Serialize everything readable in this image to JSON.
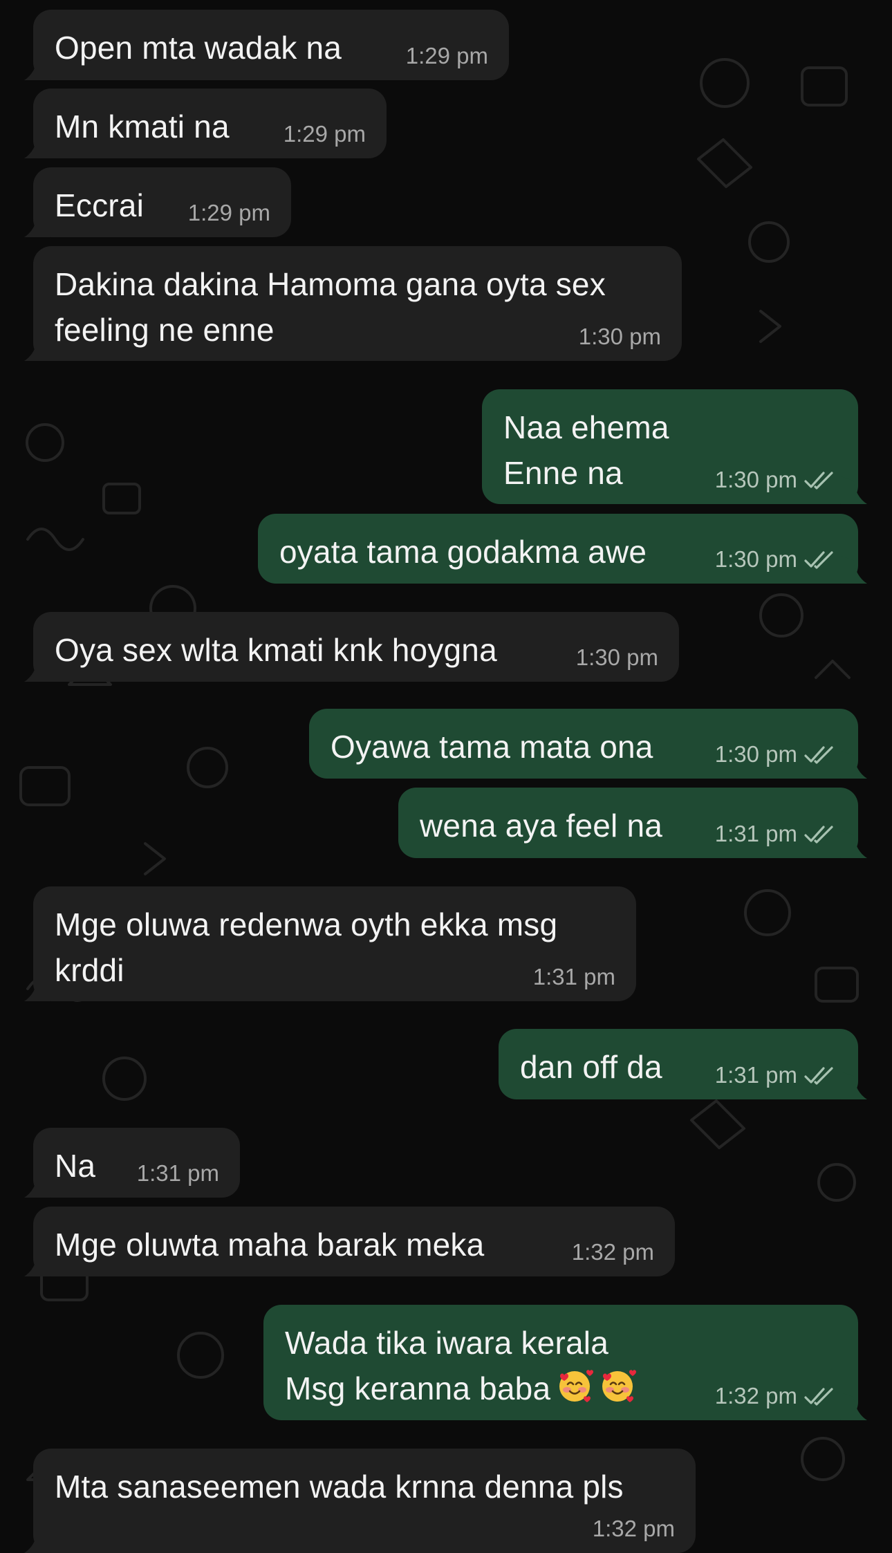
{
  "theme": {
    "background": "#0b0b0b",
    "incoming_bubble": "#202020",
    "outgoing_bubble": "#1f4a33",
    "read_tick_color": "#a7c2b1"
  },
  "messages": [
    {
      "dir": "in",
      "text": "Open mta wadak na",
      "time": "1:29 pm",
      "icon": "bubble"
    },
    {
      "dir": "in",
      "text": "Mn kmati na",
      "time": "1:29 pm",
      "icon": "bubble"
    },
    {
      "dir": "in",
      "text": "Eccrai",
      "time": "1:29 pm",
      "icon": "bubble"
    },
    {
      "dir": "in",
      "text": "Dakina dakina Hamoma gana oyta sex\nfeeling ne enne",
      "time": "1:30 pm",
      "icon": "bubble"
    },
    {
      "dir": "out",
      "text": "Naa ehema\nEnne na",
      "time": "1:30 pm",
      "status_icon": "double-check-icon"
    },
    {
      "dir": "out",
      "text": "oyata tama godakma awe",
      "time": "1:30 pm",
      "status_icon": "double-check-icon"
    },
    {
      "dir": "in",
      "text": "Oya sex wlta kmati knk hoygna",
      "time": "1:30 pm",
      "icon": "bubble"
    },
    {
      "dir": "out",
      "text": "Oyawa tama mata ona",
      "time": "1:30 pm",
      "status_icon": "double-check-icon"
    },
    {
      "dir": "out",
      "text": "wena aya feel na",
      "time": "1:31 pm",
      "status_icon": "double-check-icon"
    },
    {
      "dir": "in",
      "text": "Mge oluwa redenwa oyth ekka msg\nkrddi",
      "time": "1:31 pm",
      "icon": "bubble"
    },
    {
      "dir": "out",
      "text": "dan off da",
      "time": "1:31 pm",
      "status_icon": "double-check-icon"
    },
    {
      "dir": "in",
      "text": "Na",
      "time": "1:31 pm",
      "icon": "bubble"
    },
    {
      "dir": "in",
      "text": "Mge oluwta  maha barak meka",
      "time": "1:32 pm",
      "icon": "bubble"
    },
    {
      "dir": "out",
      "text": "Wada tika iwara kerala\nMsg keranna baba",
      "emojis": [
        "smiling-face-with-hearts-icon",
        "smiling-face-with-hearts-icon"
      ],
      "time": "1:32 pm",
      "status_icon": "double-check-icon"
    },
    {
      "dir": "in",
      "text": "Mta sanaseemen wada krnna denna pls",
      "time": "1:32 pm",
      "icon": "bubble"
    }
  ]
}
